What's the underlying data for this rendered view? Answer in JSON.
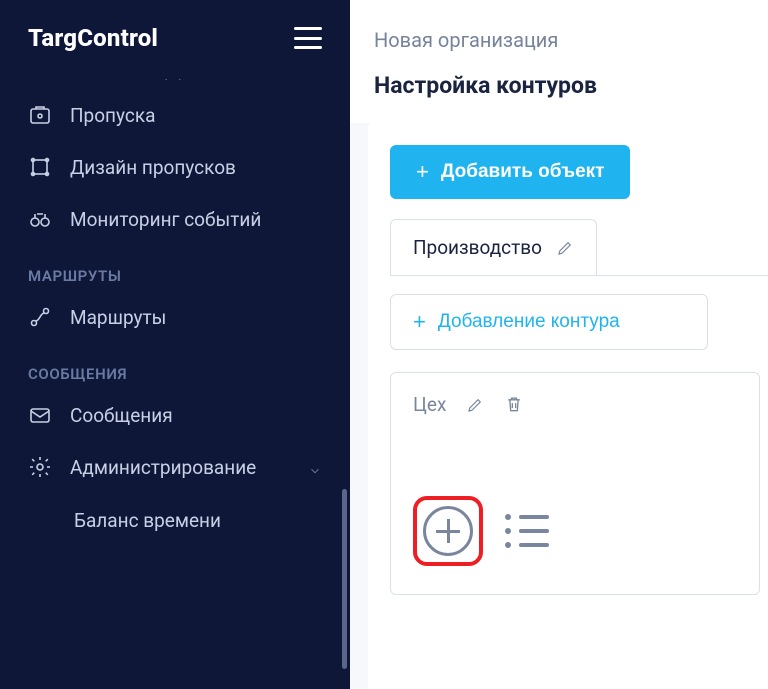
{
  "brand": "TargControl",
  "org_name": "Новая организация",
  "page_title": "Настройка контуров",
  "sidebar": {
    "items_top": [
      {
        "label": "Пропуска",
        "icon": "passes"
      },
      {
        "label": "Дизайн пропусков",
        "icon": "design"
      },
      {
        "label": "Мониторинг событий",
        "icon": "monitoring"
      }
    ],
    "section_routes": "МАРШРУТЫ",
    "item_routes": "Маршруты",
    "section_messages": "СООБЩЕНИЯ",
    "item_messages": "Сообщения",
    "item_admin": "Администрирование",
    "sub_balance": "Баланс времени"
  },
  "buttons": {
    "add_object": "Добавить объект",
    "add_contour": "Добавление контура"
  },
  "tab": {
    "label": "Производство"
  },
  "card": {
    "title": "Цех"
  }
}
